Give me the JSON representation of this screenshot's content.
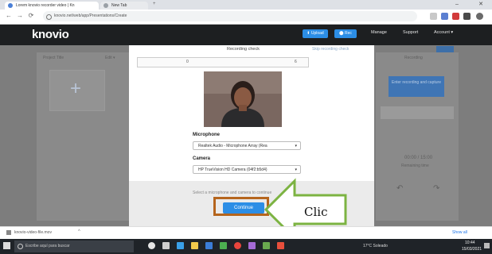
{
  "browser": {
    "tabs": [
      {
        "label": "Lorem knovio recorder video | Kn"
      },
      {
        "label": "New Tab"
      }
    ],
    "url": "knovio.net/web/app/Presentations/Create",
    "nav": {
      "back": "←",
      "forward": "→",
      "reload": "⟳",
      "new_tab": "+"
    },
    "window": {
      "minimize": "–",
      "close": "✕"
    }
  },
  "header": {
    "logo": "knovio",
    "buttons": [
      {
        "label": "⬆ Upload",
        "color": "#2c8ee6"
      },
      {
        "label": "⬤ Rec",
        "color": "#2c8ee6"
      }
    ],
    "links": [
      "Manage",
      "Support",
      "Account ▾"
    ]
  },
  "left_panel": {
    "title": "Project Title",
    "action": "Edit ▾",
    "plus": "+"
  },
  "right_panel": {
    "title": "Recording",
    "button": "Enter recording and capture",
    "time": "00:00 / 15:00",
    "remaining": "Remaining time",
    "icon_left": "↶",
    "icon_right": "↷"
  },
  "modal": {
    "title": "Recording check",
    "top_link": "Skip recording check",
    "meter_left": "0",
    "meter_right": "6",
    "microphone_label": "Microphone",
    "microphone_value": "Realtek Audio - Microphone Array (Rea",
    "camera_label": "Camera",
    "camera_value": "HP TrueVision HD Camera (04f2:b5d4)",
    "footer_hint": "Select a microphone and camera to continue",
    "continue_button": "Continue"
  },
  "annotation": {
    "label": "Clic",
    "arrow_color": "#7cb342",
    "highlight_color": "#b5651d"
  },
  "downloads": {
    "item": "knovio-video-file.mov",
    "show_all": "Show all"
  },
  "taskbar": {
    "search_placeholder": "Escribe aquí para buscar",
    "weather": "17°C Soleado",
    "time": "10:44",
    "date": "15/03/2021"
  }
}
